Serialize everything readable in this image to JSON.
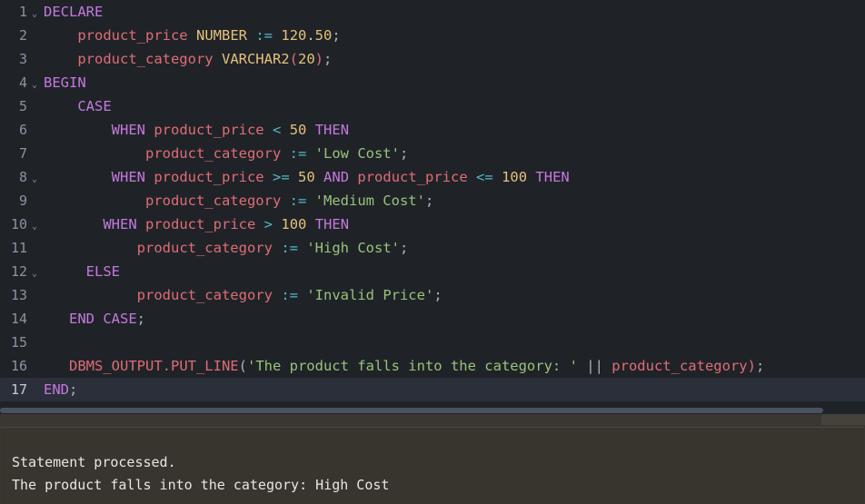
{
  "editor": {
    "active_line": 17,
    "colors": {
      "background": "#1f2328",
      "active_line_background": "#2a2f3a",
      "gutter_text": "#8a93a3",
      "keyword": "#c678dd",
      "identifier": "#e06c75",
      "datatype": "#e5c07b",
      "number": "#e5c07b",
      "string": "#98c379",
      "operator": "#56b6c2",
      "punctuation": "#abb2bf"
    },
    "fold_marker": "⌄",
    "lines": [
      {
        "number": "1",
        "fold": true,
        "tokens": [
          {
            "t": "DECLARE",
            "c": "kw"
          }
        ]
      },
      {
        "number": "2",
        "fold": false,
        "tokens": [
          {
            "t": "    ",
            "c": "pun"
          },
          {
            "t": "product_price",
            "c": "id"
          },
          {
            "t": " ",
            "c": "pun"
          },
          {
            "t": "NUMBER",
            "c": "typ"
          },
          {
            "t": " ",
            "c": "pun"
          },
          {
            "t": ":=",
            "c": "op"
          },
          {
            "t": " ",
            "c": "pun"
          },
          {
            "t": "120.50",
            "c": "num"
          },
          {
            "t": ";",
            "c": "pun"
          }
        ]
      },
      {
        "number": "3",
        "fold": false,
        "tokens": [
          {
            "t": "    ",
            "c": "pun"
          },
          {
            "t": "product_category",
            "c": "id"
          },
          {
            "t": " ",
            "c": "pun"
          },
          {
            "t": "VARCHAR2",
            "c": "typ"
          },
          {
            "t": "(",
            "c": "id"
          },
          {
            "t": "20",
            "c": "num"
          },
          {
            "t": ")",
            "c": "id"
          },
          {
            "t": ";",
            "c": "pun"
          }
        ]
      },
      {
        "number": "4",
        "fold": true,
        "tokens": [
          {
            "t": "BEGIN",
            "c": "kw"
          }
        ]
      },
      {
        "number": "5",
        "fold": false,
        "tokens": [
          {
            "t": "    ",
            "c": "pun"
          },
          {
            "t": "CASE",
            "c": "kw"
          }
        ]
      },
      {
        "number": "6",
        "fold": false,
        "tokens": [
          {
            "t": "        ",
            "c": "pun"
          },
          {
            "t": "WHEN",
            "c": "kw"
          },
          {
            "t": " ",
            "c": "pun"
          },
          {
            "t": "product_price",
            "c": "id"
          },
          {
            "t": " ",
            "c": "pun"
          },
          {
            "t": "<",
            "c": "op"
          },
          {
            "t": " ",
            "c": "pun"
          },
          {
            "t": "50",
            "c": "num"
          },
          {
            "t": " ",
            "c": "pun"
          },
          {
            "t": "THEN",
            "c": "kw"
          }
        ]
      },
      {
        "number": "7",
        "fold": false,
        "tokens": [
          {
            "t": "            ",
            "c": "pun"
          },
          {
            "t": "product_category",
            "c": "id"
          },
          {
            "t": " ",
            "c": "pun"
          },
          {
            "t": ":=",
            "c": "op"
          },
          {
            "t": " ",
            "c": "pun"
          },
          {
            "t": "'Low Cost'",
            "c": "str"
          },
          {
            "t": ";",
            "c": "pun"
          }
        ]
      },
      {
        "number": "8",
        "fold": true,
        "tokens": [
          {
            "t": "        ",
            "c": "pun"
          },
          {
            "t": "WHEN",
            "c": "kw"
          },
          {
            "t": " ",
            "c": "pun"
          },
          {
            "t": "product_price",
            "c": "id"
          },
          {
            "t": " ",
            "c": "pun"
          },
          {
            "t": ">=",
            "c": "op"
          },
          {
            "t": " ",
            "c": "pun"
          },
          {
            "t": "50",
            "c": "num"
          },
          {
            "t": " ",
            "c": "pun"
          },
          {
            "t": "AND",
            "c": "kw"
          },
          {
            "t": " ",
            "c": "pun"
          },
          {
            "t": "product_price",
            "c": "id"
          },
          {
            "t": " ",
            "c": "pun"
          },
          {
            "t": "<=",
            "c": "op"
          },
          {
            "t": " ",
            "c": "pun"
          },
          {
            "t": "100",
            "c": "num"
          },
          {
            "t": " ",
            "c": "pun"
          },
          {
            "t": "THEN",
            "c": "kw"
          }
        ]
      },
      {
        "number": "9",
        "fold": false,
        "tokens": [
          {
            "t": "            ",
            "c": "pun"
          },
          {
            "t": "product_category",
            "c": "id"
          },
          {
            "t": " ",
            "c": "pun"
          },
          {
            "t": ":=",
            "c": "op"
          },
          {
            "t": " ",
            "c": "pun"
          },
          {
            "t": "'Medium Cost'",
            "c": "str"
          },
          {
            "t": ";",
            "c": "pun"
          }
        ]
      },
      {
        "number": "10",
        "fold": true,
        "tokens": [
          {
            "t": "       ",
            "c": "pun"
          },
          {
            "t": "WHEN",
            "c": "kw"
          },
          {
            "t": " ",
            "c": "pun"
          },
          {
            "t": "product_price",
            "c": "id"
          },
          {
            "t": " ",
            "c": "pun"
          },
          {
            "t": ">",
            "c": "op"
          },
          {
            "t": " ",
            "c": "pun"
          },
          {
            "t": "100",
            "c": "num"
          },
          {
            "t": " ",
            "c": "pun"
          },
          {
            "t": "THEN",
            "c": "kw"
          }
        ]
      },
      {
        "number": "11",
        "fold": false,
        "tokens": [
          {
            "t": "           ",
            "c": "pun"
          },
          {
            "t": "product_category",
            "c": "id"
          },
          {
            "t": " ",
            "c": "pun"
          },
          {
            "t": ":=",
            "c": "op"
          },
          {
            "t": " ",
            "c": "pun"
          },
          {
            "t": "'High Cost'",
            "c": "str"
          },
          {
            "t": ";",
            "c": "pun"
          }
        ]
      },
      {
        "number": "12",
        "fold": true,
        "tokens": [
          {
            "t": "     ",
            "c": "pun"
          },
          {
            "t": "ELSE",
            "c": "kw"
          }
        ]
      },
      {
        "number": "13",
        "fold": false,
        "tokens": [
          {
            "t": "           ",
            "c": "pun"
          },
          {
            "t": "product_category",
            "c": "id"
          },
          {
            "t": " ",
            "c": "pun"
          },
          {
            "t": ":=",
            "c": "op"
          },
          {
            "t": " ",
            "c": "pun"
          },
          {
            "t": "'Invalid Price'",
            "c": "str"
          },
          {
            "t": ";",
            "c": "pun"
          }
        ]
      },
      {
        "number": "14",
        "fold": false,
        "tokens": [
          {
            "t": "   ",
            "c": "pun"
          },
          {
            "t": "END CASE",
            "c": "kw"
          },
          {
            "t": ";",
            "c": "pun"
          }
        ]
      },
      {
        "number": "15",
        "fold": false,
        "tokens": []
      },
      {
        "number": "16",
        "fold": false,
        "tokens": [
          {
            "t": "   ",
            "c": "pun"
          },
          {
            "t": "DBMS_OUTPUT.PUT_LINE",
            "c": "id"
          },
          {
            "t": "(",
            "c": "pun"
          },
          {
            "t": "'The product falls into the category: '",
            "c": "str"
          },
          {
            "t": " ",
            "c": "pun"
          },
          {
            "t": "||",
            "c": "pun"
          },
          {
            "t": " ",
            "c": "pun"
          },
          {
            "t": "product_category",
            "c": "id"
          },
          {
            "t": ")",
            "c": "id"
          },
          {
            "t": ";",
            "c": "pun"
          }
        ]
      },
      {
        "number": "17",
        "fold": false,
        "active": true,
        "tokens": [
          {
            "t": "END",
            "c": "kw"
          },
          {
            "t": ";",
            "c": "pun"
          }
        ]
      }
    ]
  },
  "output": {
    "lines": [
      "Statement processed.",
      "The product falls into the category: High Cost"
    ]
  }
}
